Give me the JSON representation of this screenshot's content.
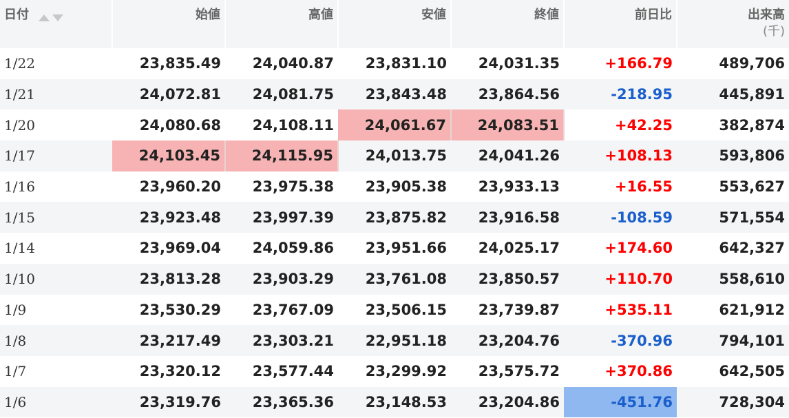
{
  "columns": {
    "date": "日付",
    "open": "始値",
    "high": "高値",
    "low": "安値",
    "close": "終値",
    "change": "前日比",
    "volume": "出来高",
    "volume_unit": "(千)"
  },
  "icons": {
    "sort_asc": "triangle-up-icon",
    "sort_desc": "triangle-down-icon"
  },
  "colors": {
    "positive": "#ff0000",
    "negative": "#1a5fcc",
    "highlight_red": "#f7b3b3",
    "highlight_blue": "#8fb8f0"
  },
  "rows": [
    {
      "date": "1/22",
      "open": "23,835.49",
      "high": "24,040.87",
      "low": "23,831.10",
      "close": "24,031.35",
      "change": "+166.79",
      "volume": "489,706",
      "dir": "pos",
      "hl": []
    },
    {
      "date": "1/21",
      "open": "24,072.81",
      "high": "24,081.75",
      "low": "23,843.48",
      "close": "23,864.56",
      "change": "-218.95",
      "volume": "445,891",
      "dir": "neg",
      "hl": []
    },
    {
      "date": "1/20",
      "open": "24,080.68",
      "high": "24,108.11",
      "low": "24,061.67",
      "close": "24,083.51",
      "change": "+42.25",
      "volume": "382,874",
      "dir": "pos",
      "hl": [
        "low",
        "close"
      ]
    },
    {
      "date": "1/17",
      "open": "24,103.45",
      "high": "24,115.95",
      "low": "24,013.75",
      "close": "24,041.26",
      "change": "+108.13",
      "volume": "593,806",
      "dir": "pos",
      "hl": [
        "open",
        "high"
      ]
    },
    {
      "date": "1/16",
      "open": "23,960.20",
      "high": "23,975.38",
      "low": "23,905.38",
      "close": "23,933.13",
      "change": "+16.55",
      "volume": "553,627",
      "dir": "pos",
      "hl": []
    },
    {
      "date": "1/15",
      "open": "23,923.48",
      "high": "23,997.39",
      "low": "23,875.82",
      "close": "23,916.58",
      "change": "-108.59",
      "volume": "571,554",
      "dir": "neg",
      "hl": []
    },
    {
      "date": "1/14",
      "open": "23,969.04",
      "high": "24,059.86",
      "low": "23,951.66",
      "close": "24,025.17",
      "change": "+174.60",
      "volume": "642,327",
      "dir": "pos",
      "hl": []
    },
    {
      "date": "1/10",
      "open": "23,813.28",
      "high": "23,903.29",
      "low": "23,761.08",
      "close": "23,850.57",
      "change": "+110.70",
      "volume": "558,610",
      "dir": "pos",
      "hl": []
    },
    {
      "date": "1/9",
      "open": "23,530.29",
      "high": "23,767.09",
      "low": "23,506.15",
      "close": "23,739.87",
      "change": "+535.11",
      "volume": "621,912",
      "dir": "pos",
      "hl": []
    },
    {
      "date": "1/8",
      "open": "23,217.49",
      "high": "23,303.21",
      "low": "22,951.18",
      "close": "23,204.76",
      "change": "-370.96",
      "volume": "794,101",
      "dir": "neg",
      "hl": []
    },
    {
      "date": "1/7",
      "open": "23,320.12",
      "high": "23,577.44",
      "low": "23,299.92",
      "close": "23,575.72",
      "change": "+370.86",
      "volume": "642,505",
      "dir": "pos",
      "hl": []
    },
    {
      "date": "1/6",
      "open": "23,319.76",
      "high": "23,365.36",
      "low": "23,148.53",
      "close": "23,204.86",
      "change": "-451.76",
      "volume": "728,304",
      "dir": "neg",
      "hl": [
        "change"
      ]
    }
  ]
}
